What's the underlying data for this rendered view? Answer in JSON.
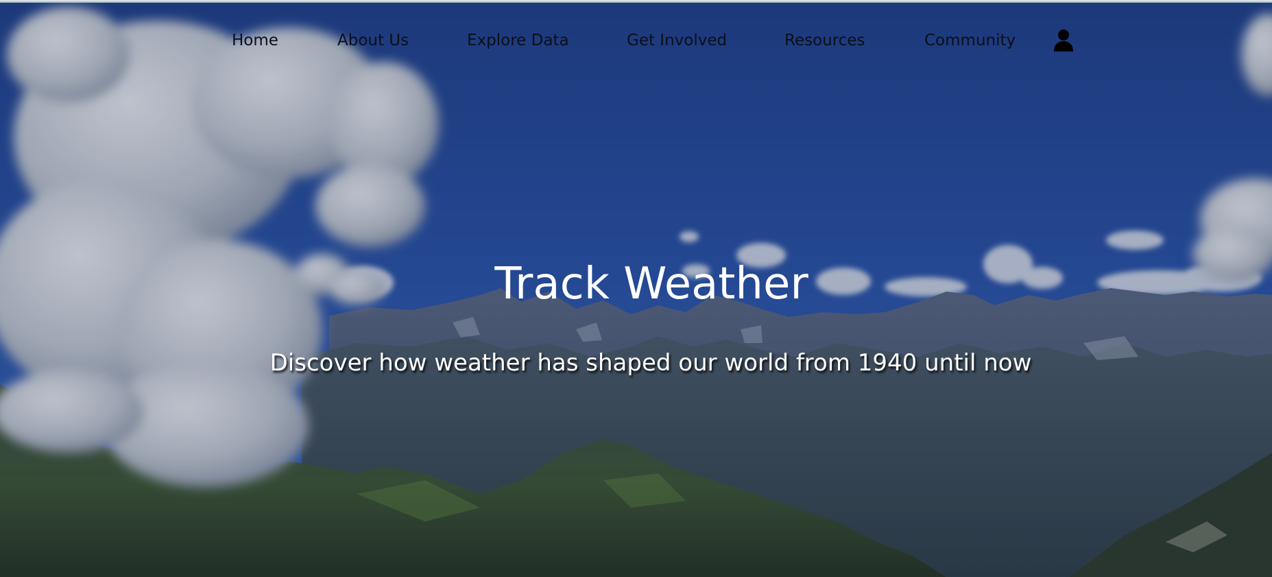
{
  "nav": {
    "items": [
      {
        "label": "Home"
      },
      {
        "label": "About Us"
      },
      {
        "label": "Explore Data"
      },
      {
        "label": "Get Involved"
      },
      {
        "label": "Resources"
      },
      {
        "label": "Community"
      }
    ],
    "account_icon": "user-icon"
  },
  "hero": {
    "title": "Track Weather",
    "subtitle": "Discover how weather has shaped our world from 1940 until now",
    "background": "mountain-landscape-with-clouds"
  },
  "colors": {
    "sky": "#24489a",
    "overlay": "#0f1f46",
    "nav_text": "#0b0f1a",
    "text": "#ffffff"
  }
}
